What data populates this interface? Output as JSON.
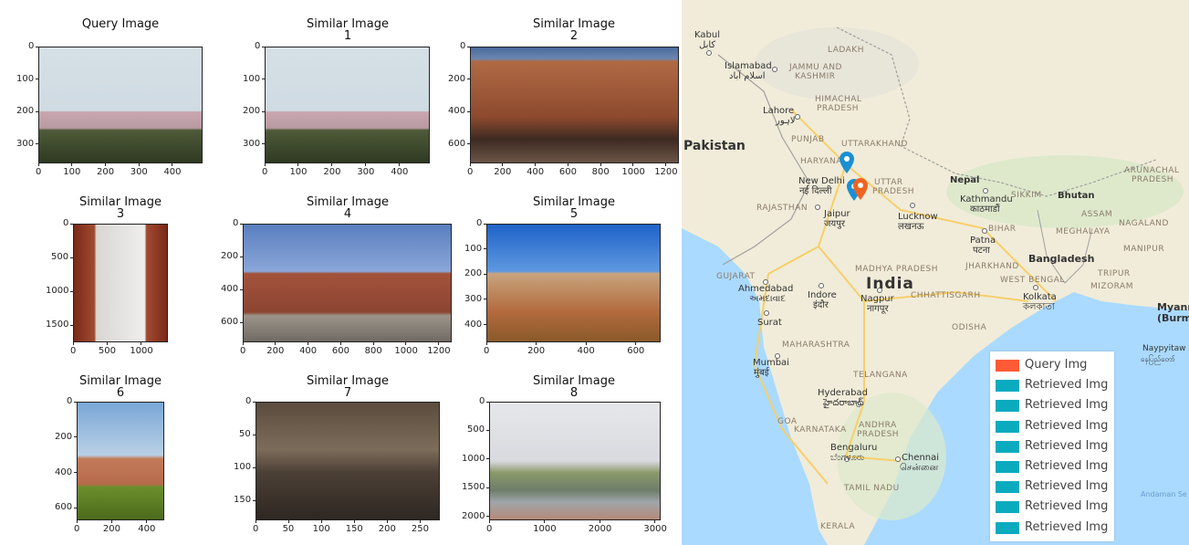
{
  "panels": [
    {
      "title": "Query Image",
      "xticks": [
        "0",
        "100",
        "200",
        "300",
        "400"
      ],
      "yticks": [
        "0",
        "100",
        "200",
        "300"
      ],
      "xrange": [
        0,
        490
      ],
      "yrange": [
        0,
        360
      ]
    },
    {
      "title": "Similar Image\n1",
      "xticks": [
        "0",
        "100",
        "200",
        "300",
        "400"
      ],
      "yticks": [
        "0",
        "100",
        "200",
        "300"
      ],
      "xrange": [
        0,
        490
      ],
      "yrange": [
        0,
        360
      ]
    },
    {
      "title": "Similar Image\n2",
      "xticks": [
        "0",
        "200",
        "400",
        "600",
        "800",
        "1000",
        "1200"
      ],
      "yticks": [
        "0",
        "200",
        "400",
        "600"
      ],
      "xrange": [
        0,
        1280
      ],
      "yrange": [
        0,
        720
      ]
    },
    {
      "title": "Similar Image\n3",
      "xticks": [
        "0",
        "500",
        "1000"
      ],
      "yticks": [
        "0",
        "500",
        "1000",
        "1500"
      ],
      "xrange": [
        0,
        1390
      ],
      "yrange": [
        0,
        1750
      ]
    },
    {
      "title": "Similar Image\n4",
      "xticks": [
        "0",
        "200",
        "400",
        "600",
        "800",
        "1000",
        "1200"
      ],
      "yticks": [
        "0",
        "200",
        "400",
        "600"
      ],
      "xrange": [
        0,
        1280
      ],
      "yrange": [
        0,
        720
      ]
    },
    {
      "title": "Similar Image\n5",
      "xticks": [
        "0",
        "200",
        "400",
        "600"
      ],
      "yticks": [
        "0",
        "100",
        "200",
        "300",
        "400"
      ],
      "xrange": [
        0,
        700
      ],
      "yrange": [
        0,
        470
      ]
    },
    {
      "title": "Similar Image\n6",
      "xticks": [
        "0",
        "200",
        "400"
      ],
      "yticks": [
        "0",
        "200",
        "400",
        "600"
      ],
      "xrange": [
        0,
        500
      ],
      "yrange": [
        0,
        670
      ]
    },
    {
      "title": "Similar Image\n7",
      "xticks": [
        "0",
        "50",
        "100",
        "150",
        "200",
        "250"
      ],
      "yticks": [
        "0",
        "50",
        "100",
        "150"
      ],
      "xrange": [
        0,
        280
      ],
      "yrange": [
        0,
        180
      ]
    },
    {
      "title": "Similar Image\n8",
      "xticks": [
        "0",
        "1000",
        "2000",
        "3000"
      ],
      "yticks": [
        "0",
        "500",
        "1000",
        "1500",
        "2000"
      ],
      "xrange": [
        0,
        3100
      ],
      "yrange": [
        0,
        2070
      ]
    }
  ],
  "map": {
    "countries": {
      "pakistan": "Pakistan",
      "india": "India",
      "nepal": "Nepal",
      "bhutan": "Bhutan",
      "bangladesh": "Bangladesh",
      "myanmar1": "Myanm",
      "myanmar2": "(Burm"
    },
    "regions": {
      "ladakh": "LADAKH",
      "jk1": "JAMMU AND",
      "jk2": "KASHMIR",
      "hp1": "HIMACHAL",
      "hp2": "PRADESH",
      "punjab": "PUNJAB",
      "uttarakhand": "UTTARAKHAND",
      "haryana": "HARYANA",
      "up1": "UTTAR",
      "up2": "PRADESH",
      "rajasthan": "RAJASTHAN",
      "bihar": "BIHAR",
      "sikkim": "SIKKIM",
      "ap1": "ARUNACHAL",
      "ap2": "PRADESH",
      "assam": "ASSAM",
      "nagaland": "NAGALAND",
      "meghalaya": "MEGHALAYA",
      "manipur": "MANIPUR",
      "jharkhand": "JHARKHAND",
      "westbengal": "WEST BENGAL",
      "tripura": "TRIPUR",
      "mizoram": "MIZORAM",
      "gujarat": "GUJARAT",
      "mp": "MADHYA PRADESH",
      "chhattisgarh": "CHHATTISGARH",
      "odisha": "ODISHA",
      "maharashtra": "MAHARASHTRA",
      "telangana": "TELANGANA",
      "goa": "GOA",
      "karnataka": "KARNATAKA",
      "andhra1": "ANDHRA",
      "andhra2": "PRADESH",
      "tamilnadu": "TAMIL NADU",
      "kerala": "KERALA",
      "andaman": "Andaman Se"
    },
    "cities": {
      "kabul": "Kabul",
      "kabul_local": "کابل",
      "islamabad": "Islamabad",
      "islamabad_local": "اسلام آباد",
      "lahore": "Lahore",
      "lahore_local": "لاہور",
      "newdelhi": "New Delhi",
      "newdelhi_local": "नई दिल्ली",
      "jaipur": "Jaipur",
      "jaipur_local": "जयपुर",
      "lucknow": "Lucknow",
      "lucknow_local": "लखनऊ",
      "kathmandu": "Kathmandu",
      "kathmandu_local": "काठमाडौं",
      "patna": "Patna",
      "patna_local": "पटना",
      "ahmedabad": "Ahmedabad",
      "ahmedabad_local": "અમદાવાદ",
      "indore": "Indore",
      "indore_local": "इंदौर",
      "nagpur": "Nagpur",
      "nagpur_local": "नागपूर",
      "kolkata": "Kolkata",
      "kolkata_local": "কলকাতা",
      "surat": "Surat",
      "mumbai": "Mumbai",
      "mumbai_local": "मुंबई",
      "hyderabad": "Hyderabad",
      "hyderabad_local": "హైదరాబాద్",
      "bengaluru": "Bengaluru",
      "bengaluru_local": "ಬೆಂಗಳೂರು",
      "chennai": "Chennai",
      "chennai_local": "சென்னை",
      "naypyitaw": "Naypyitaw",
      "naypyitaw_local": "နေပြည်တော်"
    },
    "legend": [
      {
        "label": "Query Img",
        "color": "#ff5a36"
      },
      {
        "label": "Retrieved Img",
        "color": "#0aabbf"
      },
      {
        "label": "Retrieved Img",
        "color": "#0aabbf"
      },
      {
        "label": "Retrieved Img",
        "color": "#0aabbf"
      },
      {
        "label": "Retrieved Img",
        "color": "#0aabbf"
      },
      {
        "label": "Retrieved Img",
        "color": "#0aabbf"
      },
      {
        "label": "Retrieved Img",
        "color": "#0aabbf"
      },
      {
        "label": "Retrieved Img",
        "color": "#0aabbf"
      },
      {
        "label": "Retrieved Img",
        "color": "#0aabbf"
      }
    ],
    "markers": [
      {
        "name": "retrieved-marker-haryana",
        "color": "#1a8fd4"
      },
      {
        "name": "retrieved-marker-delhi",
        "color": "#1a8fd4"
      },
      {
        "name": "query-marker-agra",
        "color": "#ef6321"
      }
    ]
  }
}
